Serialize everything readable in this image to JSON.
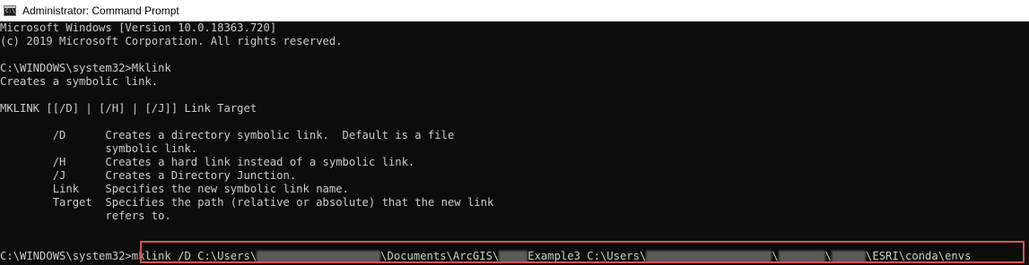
{
  "window": {
    "title": "Administrator: Command Prompt",
    "icon": "cmd-icon",
    "icon_text": "C:\\"
  },
  "console": {
    "lines": [
      "Microsoft Windows [Version 10.0.18363.720]",
      "(c) 2019 Microsoft Corporation. All rights reserved.",
      "",
      "C:\\WINDOWS\\system32>Mklink",
      "Creates a symbolic link.",
      "",
      "MKLINK [[/D] | [/H] | [/J]] Link Target",
      "",
      "        /D      Creates a directory symbolic link.  Default is a file",
      "                symbolic link.",
      "        /H      Creates a hard link instead of a symbolic link.",
      "        /J      Creates a Directory Junction.",
      "        Link    Specifies the new symbolic link name.",
      "        Target  Specifies the path (relative or absolute) that the new link",
      "                refers to."
    ],
    "command": {
      "prompt": "C:\\WINDOWS\\system32>",
      "part1": "mklink /D C:\\Users\\",
      "part2": "\\Documents\\ArcGIS\\",
      "part3": "Example3 C:\\Users\\",
      "part4": "\\",
      "part5": "\\",
      "part6": "\\ESRI\\conda\\envs"
    }
  },
  "colors": {
    "background": "#0c0c0c",
    "text": "#cccccc",
    "highlight": "#d9534f"
  }
}
